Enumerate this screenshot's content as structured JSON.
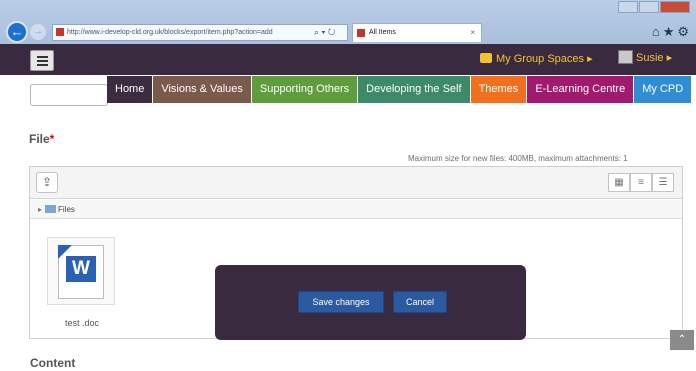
{
  "browser": {
    "url": "http://www.i-develop-cld.org.uk/blocks/export/item.php?action=add",
    "tab_title": "All Items",
    "tab_close": "×",
    "address_tools": "⌕ ▾ ↻"
  },
  "header": {
    "group_spaces": "My Group Spaces ▸",
    "user_name": "Susie ▸"
  },
  "nav": {
    "items": [
      {
        "label": "Home",
        "color": "#3b2c40"
      },
      {
        "label": "Visions & Values",
        "color": "#7a5a4a"
      },
      {
        "label": "Supporting Others",
        "color": "#5f9c3e"
      },
      {
        "label": "Developing the Self",
        "color": "#3d8a6b"
      },
      {
        "label": "Themes",
        "color": "#f07020"
      },
      {
        "label": "E-Learning Centre",
        "color": "#a21a6e"
      },
      {
        "label": "My CPD",
        "color": "#2f8ed3"
      }
    ]
  },
  "file_section": {
    "label": "File",
    "required_mark": "*",
    "max_size_note": "Maximum size for new files: 400MB, maximum attachments: 1",
    "path_root": "Files",
    "file_name": "test .doc",
    "word_letter": "W"
  },
  "dialog": {
    "save_label": "Save changes",
    "cancel_label": "Cancel"
  },
  "content_label": "Content"
}
